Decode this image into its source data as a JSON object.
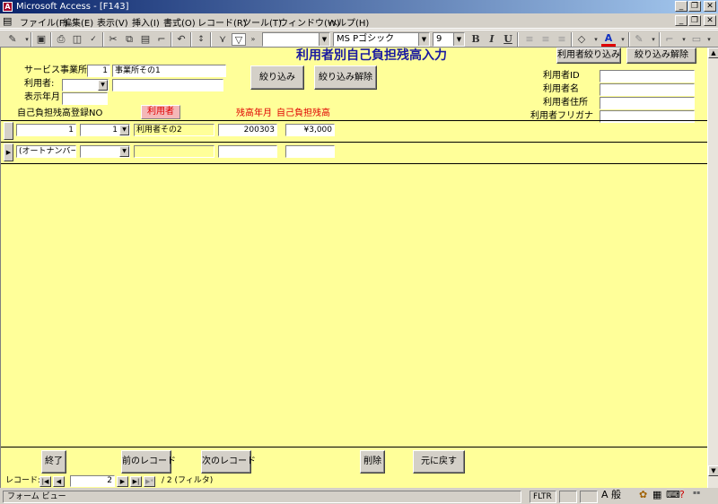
{
  "window": {
    "title": "Microsoft Access - [F143]"
  },
  "menu": [
    "ファイル(F)",
    "編集(E)",
    "表示(V)",
    "挿入(I)",
    "書式(O)",
    "レコード(R)",
    "ツール(T)",
    "ウィンドウ(W)",
    "ヘルプ(H)"
  ],
  "toolbar": {
    "font_name": "MS Pゴシック",
    "font_size": "9",
    "field_combo": ""
  },
  "form": {
    "title": "利用者別自己負担残高入力",
    "service_label": "サービス事業所",
    "service_no": "1",
    "service_name": "事業所その1",
    "user_label": "利用者:",
    "user_value": "",
    "user_name": "",
    "month_label": "表示年月",
    "month_value": "",
    "filter_button": "絞り込み",
    "filter_clear_button": "絞り込み解除",
    "user_filter_button": "利用者絞り込み",
    "user_filter_clear_button": "絞り込み解除",
    "user_id_label": "利用者ID",
    "user_name_label": "利用者名",
    "user_address_label": "利用者住所",
    "user_furigana_label": "利用者フリガナ",
    "user_id_value": "",
    "user_name_value": "",
    "user_address_value": "",
    "user_furigana_value": "",
    "col_reg_no": "自己負担残高登録NO",
    "col_user": "利用者",
    "col_month": "残高年月",
    "col_balance": "自己負担残高",
    "rows": [
      {
        "reg_no": "1",
        "user_no": "1",
        "user_name": "利用者その2",
        "month": "200303",
        "balance": "¥3,000"
      }
    ],
    "new_row": {
      "reg_no": "(オートナンバー)"
    }
  },
  "footer_buttons": {
    "exit": "終了",
    "prev": "前のレコード",
    "next": "次のレコード",
    "delete": "削除",
    "undo": "元に戻す"
  },
  "nav": {
    "label": "レコード:",
    "current": "2",
    "total": "/ 2 (フィルタ)"
  },
  "status": {
    "view": "フォーム ビュー",
    "fltr": "FLTR",
    "ime": "A 般"
  }
}
